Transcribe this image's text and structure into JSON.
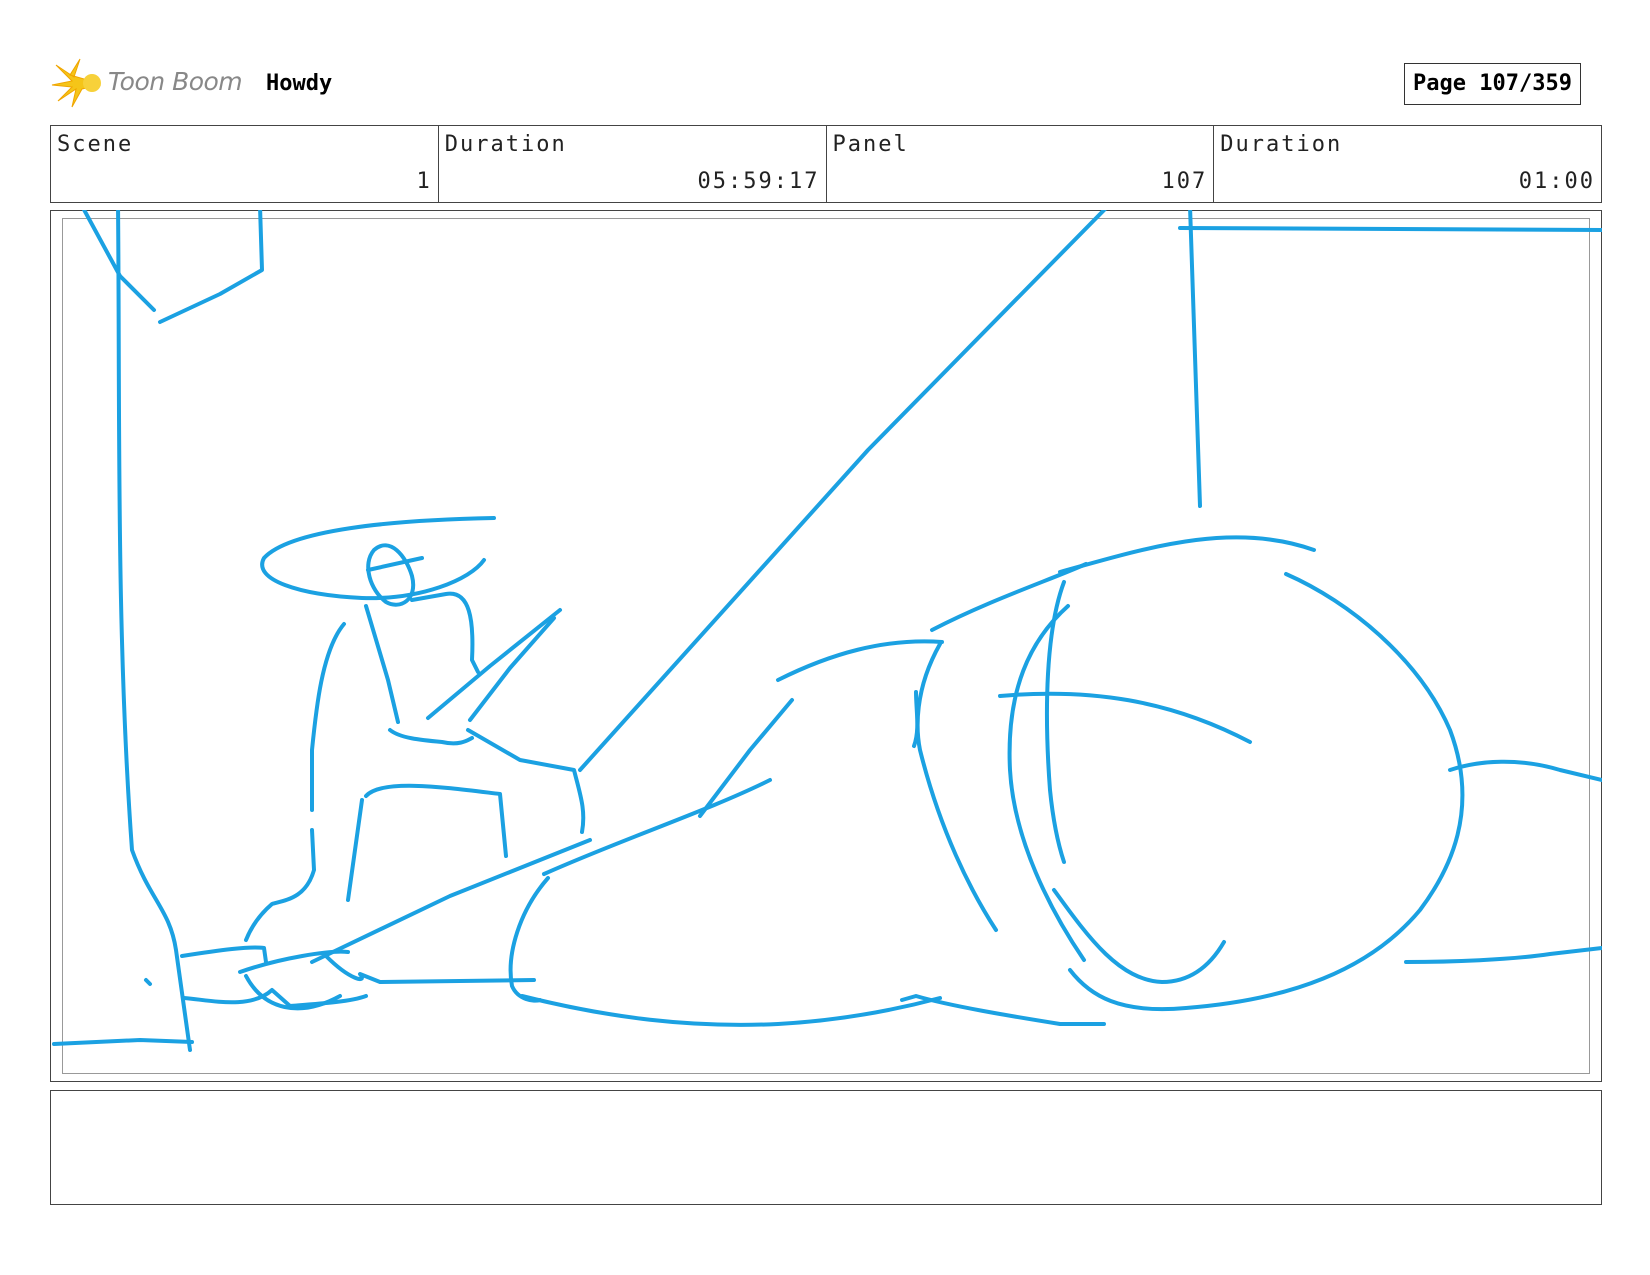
{
  "header": {
    "logo_text": "Toon Boom",
    "project_title": "Howdy",
    "page_label": "Page 107/359"
  },
  "info": [
    {
      "label": "Scene",
      "value": "1"
    },
    {
      "label": "Duration",
      "value": "05:59:17"
    },
    {
      "label": "Panel",
      "value": "107"
    },
    {
      "label": "Duration",
      "value": "01:00"
    }
  ],
  "colors": {
    "sketch_stroke": "#1ba1e2",
    "logo_star": "#f5c518"
  },
  "notes": {
    "text": ""
  }
}
